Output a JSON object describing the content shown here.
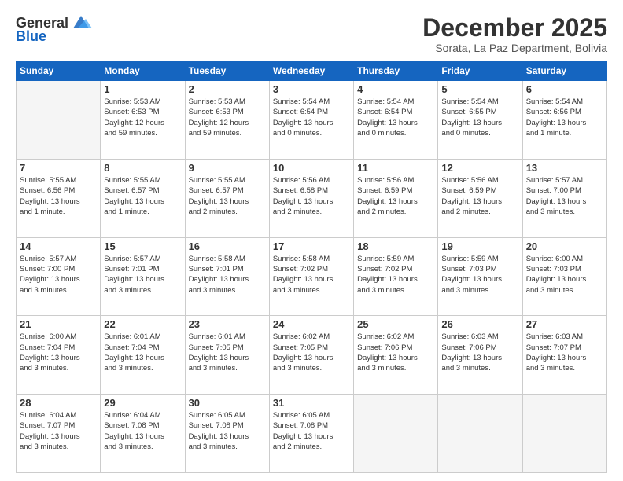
{
  "logo": {
    "line1": "General",
    "line2": "Blue"
  },
  "title": "December 2025",
  "location": "Sorata, La Paz Department, Bolivia",
  "days_header": [
    "Sunday",
    "Monday",
    "Tuesday",
    "Wednesday",
    "Thursday",
    "Friday",
    "Saturday"
  ],
  "weeks": [
    [
      {
        "day": "",
        "info": ""
      },
      {
        "day": "1",
        "info": "Sunrise: 5:53 AM\nSunset: 6:53 PM\nDaylight: 12 hours\nand 59 minutes."
      },
      {
        "day": "2",
        "info": "Sunrise: 5:53 AM\nSunset: 6:53 PM\nDaylight: 12 hours\nand 59 minutes."
      },
      {
        "day": "3",
        "info": "Sunrise: 5:54 AM\nSunset: 6:54 PM\nDaylight: 13 hours\nand 0 minutes."
      },
      {
        "day": "4",
        "info": "Sunrise: 5:54 AM\nSunset: 6:54 PM\nDaylight: 13 hours\nand 0 minutes."
      },
      {
        "day": "5",
        "info": "Sunrise: 5:54 AM\nSunset: 6:55 PM\nDaylight: 13 hours\nand 0 minutes."
      },
      {
        "day": "6",
        "info": "Sunrise: 5:54 AM\nSunset: 6:56 PM\nDaylight: 13 hours\nand 1 minute."
      }
    ],
    [
      {
        "day": "7",
        "info": "Sunrise: 5:55 AM\nSunset: 6:56 PM\nDaylight: 13 hours\nand 1 minute."
      },
      {
        "day": "8",
        "info": "Sunrise: 5:55 AM\nSunset: 6:57 PM\nDaylight: 13 hours\nand 1 minute."
      },
      {
        "day": "9",
        "info": "Sunrise: 5:55 AM\nSunset: 6:57 PM\nDaylight: 13 hours\nand 2 minutes."
      },
      {
        "day": "10",
        "info": "Sunrise: 5:56 AM\nSunset: 6:58 PM\nDaylight: 13 hours\nand 2 minutes."
      },
      {
        "day": "11",
        "info": "Sunrise: 5:56 AM\nSunset: 6:59 PM\nDaylight: 13 hours\nand 2 minutes."
      },
      {
        "day": "12",
        "info": "Sunrise: 5:56 AM\nSunset: 6:59 PM\nDaylight: 13 hours\nand 2 minutes."
      },
      {
        "day": "13",
        "info": "Sunrise: 5:57 AM\nSunset: 7:00 PM\nDaylight: 13 hours\nand 3 minutes."
      }
    ],
    [
      {
        "day": "14",
        "info": "Sunrise: 5:57 AM\nSunset: 7:00 PM\nDaylight: 13 hours\nand 3 minutes."
      },
      {
        "day": "15",
        "info": "Sunrise: 5:57 AM\nSunset: 7:01 PM\nDaylight: 13 hours\nand 3 minutes."
      },
      {
        "day": "16",
        "info": "Sunrise: 5:58 AM\nSunset: 7:01 PM\nDaylight: 13 hours\nand 3 minutes."
      },
      {
        "day": "17",
        "info": "Sunrise: 5:58 AM\nSunset: 7:02 PM\nDaylight: 13 hours\nand 3 minutes."
      },
      {
        "day": "18",
        "info": "Sunrise: 5:59 AM\nSunset: 7:02 PM\nDaylight: 13 hours\nand 3 minutes."
      },
      {
        "day": "19",
        "info": "Sunrise: 5:59 AM\nSunset: 7:03 PM\nDaylight: 13 hours\nand 3 minutes."
      },
      {
        "day": "20",
        "info": "Sunrise: 6:00 AM\nSunset: 7:03 PM\nDaylight: 13 hours\nand 3 minutes."
      }
    ],
    [
      {
        "day": "21",
        "info": "Sunrise: 6:00 AM\nSunset: 7:04 PM\nDaylight: 13 hours\nand 3 minutes."
      },
      {
        "day": "22",
        "info": "Sunrise: 6:01 AM\nSunset: 7:04 PM\nDaylight: 13 hours\nand 3 minutes."
      },
      {
        "day": "23",
        "info": "Sunrise: 6:01 AM\nSunset: 7:05 PM\nDaylight: 13 hours\nand 3 minutes."
      },
      {
        "day": "24",
        "info": "Sunrise: 6:02 AM\nSunset: 7:05 PM\nDaylight: 13 hours\nand 3 minutes."
      },
      {
        "day": "25",
        "info": "Sunrise: 6:02 AM\nSunset: 7:06 PM\nDaylight: 13 hours\nand 3 minutes."
      },
      {
        "day": "26",
        "info": "Sunrise: 6:03 AM\nSunset: 7:06 PM\nDaylight: 13 hours\nand 3 minutes."
      },
      {
        "day": "27",
        "info": "Sunrise: 6:03 AM\nSunset: 7:07 PM\nDaylight: 13 hours\nand 3 minutes."
      }
    ],
    [
      {
        "day": "28",
        "info": "Sunrise: 6:04 AM\nSunset: 7:07 PM\nDaylight: 13 hours\nand 3 minutes."
      },
      {
        "day": "29",
        "info": "Sunrise: 6:04 AM\nSunset: 7:08 PM\nDaylight: 13 hours\nand 3 minutes."
      },
      {
        "day": "30",
        "info": "Sunrise: 6:05 AM\nSunset: 7:08 PM\nDaylight: 13 hours\nand 3 minutes."
      },
      {
        "day": "31",
        "info": "Sunrise: 6:05 AM\nSunset: 7:08 PM\nDaylight: 13 hours\nand 2 minutes."
      },
      {
        "day": "",
        "info": ""
      },
      {
        "day": "",
        "info": ""
      },
      {
        "day": "",
        "info": ""
      }
    ]
  ]
}
